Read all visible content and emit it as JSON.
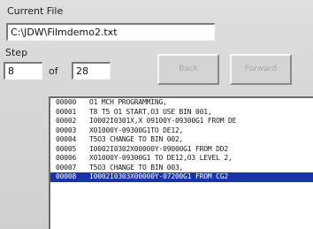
{
  "current_file": {
    "label": "Current File",
    "value": "C:\\JDW\\Filmdemo2.txt"
  },
  "step": {
    "label": "Step",
    "current": "8",
    "of_label": "of",
    "total": "28"
  },
  "buttons": {
    "left_label": "Back",
    "right_label": "Forward"
  },
  "program_lines": [
    {
      "num": "00000",
      "text": "O1 MCH PROGRAMMING,"
    },
    {
      "num": "00001",
      "text": "T8 T5 O1 START,O3 USE BIN 001,"
    },
    {
      "num": "00002",
      "text": "I0002I0301X,X 09100Y-09300G1 FROM DE"
    },
    {
      "num": "00003",
      "text": "X01000Y-09300G1TO DE12,"
    },
    {
      "num": "00004",
      "text": "T5O3 CHANGE TO BIN 002,"
    },
    {
      "num": "00005",
      "text": "I0002I0302X00000Y-09000G1 FROM DD2"
    },
    {
      "num": "00006",
      "text": "X01000Y-09300G1 TO DE12,O3 LEVEL 2,"
    },
    {
      "num": "00007",
      "text": "T5O3 CHANGE TO BIN 003,"
    },
    {
      "num": "00008",
      "text": "I0002I0303X00000Y-07200G1 FROM CG2"
    }
  ],
  "selected_index": 8,
  "colors": {
    "selection": "#1a33a8"
  }
}
